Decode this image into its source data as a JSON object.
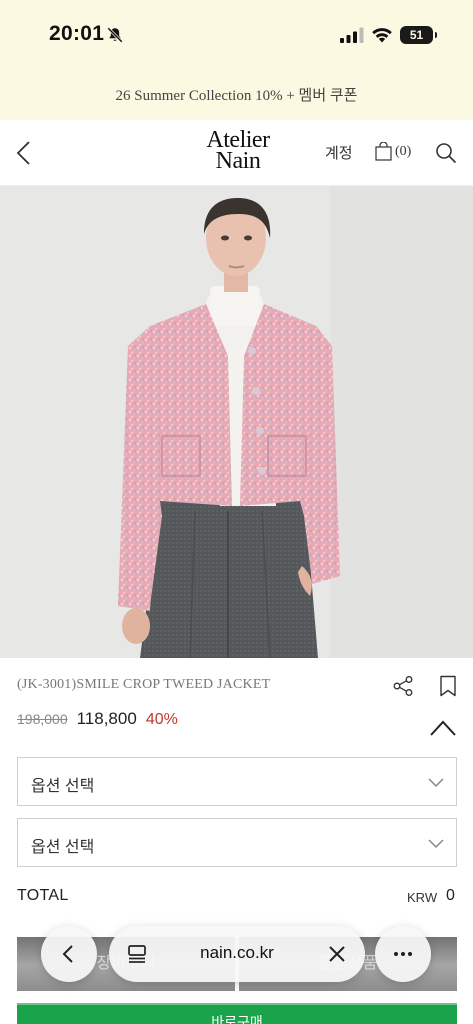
{
  "status_bar": {
    "time": "20:01",
    "battery": "51"
  },
  "promo": {
    "text": "26 Summer Collection 10% + 멤버 쿠폰"
  },
  "header": {
    "logo_line1": "Atelier",
    "logo_line2": "Nain",
    "account": "계정",
    "cart_count": "(0)"
  },
  "product": {
    "name": "(JK-3001)SMILE CROP TWEED JACKET",
    "price_old": "198,000",
    "price_new": "118,800",
    "discount": "40%",
    "colors": {
      "discount": "#c0392b",
      "buy": "#1aa34a",
      "jacket": "#e8a8b6"
    }
  },
  "options": [
    {
      "label": "옵션 선택"
    },
    {
      "label": "옵션 선택"
    }
  ],
  "total": {
    "label": "TOTAL",
    "currency": "KRW",
    "value": "0"
  },
  "actions": {
    "cart_label": "장바구니",
    "wishlist_label": "관심상품",
    "buy_label": "바로구매"
  },
  "browser": {
    "url": "nain.co.kr"
  }
}
